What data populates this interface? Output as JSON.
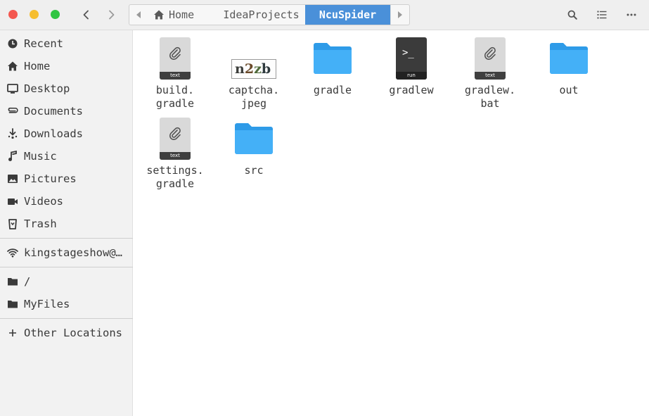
{
  "header": {
    "path": {
      "home": "Home",
      "parent": "IdeaProjects",
      "current": "NcuSpider"
    },
    "icons": {
      "back": "chevron-left-icon",
      "forward": "chevron-right-icon",
      "search": "search-icon",
      "view": "list-view-icon",
      "menu": "more-icon"
    }
  },
  "sidebar": {
    "items": [
      {
        "label": "Recent",
        "icon": "clock-icon"
      },
      {
        "label": "Home",
        "icon": "home-icon"
      },
      {
        "label": "Desktop",
        "icon": "desktop-icon"
      },
      {
        "label": "Documents",
        "icon": "documents-icon"
      },
      {
        "label": "Downloads",
        "icon": "download-icon"
      },
      {
        "label": "Music",
        "icon": "music-icon"
      },
      {
        "label": "Pictures",
        "icon": "picture-icon"
      },
      {
        "label": "Videos",
        "icon": "video-icon"
      },
      {
        "label": "Trash",
        "icon": "trash-icon"
      }
    ],
    "network": {
      "label": "kingstageshow@…",
      "icon": "network-icon"
    },
    "bookmarks": [
      {
        "label": "/",
        "icon": "folder-icon"
      },
      {
        "label": "MyFiles",
        "icon": "folder-icon"
      }
    ],
    "other": {
      "label": "Other Locations",
      "icon": "plus-icon"
    }
  },
  "files": [
    {
      "name": "build.\ngradle",
      "type": "text",
      "tag": "text"
    },
    {
      "name": "captcha.\njpeg",
      "type": "image",
      "thumb": "n2zb"
    },
    {
      "name": "gradle",
      "type": "folder"
    },
    {
      "name": "gradlew",
      "type": "executable",
      "tag": "run",
      "prompt": ">_"
    },
    {
      "name": "gradlew.\nbat",
      "type": "text",
      "tag": "text"
    },
    {
      "name": "out",
      "type": "folder"
    },
    {
      "name": "settings.\ngradle",
      "type": "text",
      "tag": "text"
    },
    {
      "name": "src",
      "type": "folder"
    }
  ],
  "colors": {
    "accent": "#4a90d9",
    "folder": "#3fa9f5",
    "close": "#f4574f",
    "minimize": "#f6be2f",
    "maximize": "#2fc542"
  }
}
